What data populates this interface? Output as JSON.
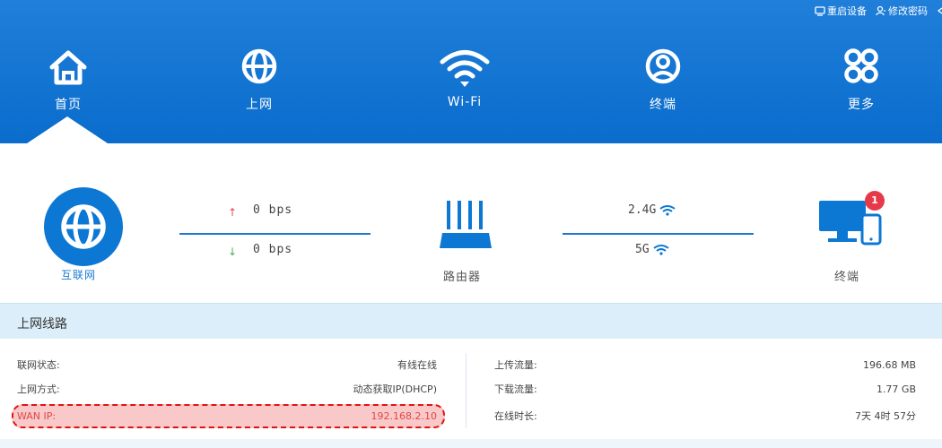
{
  "header": {
    "top_links": [
      {
        "label": "重启设备",
        "icon": "reboot-icon"
      },
      {
        "label": "修改密码",
        "icon": "user-key-icon"
      }
    ],
    "nav": [
      {
        "label": "首页",
        "icon": "home-icon",
        "active": true
      },
      {
        "label": "上网",
        "icon": "globe-icon"
      },
      {
        "label": "Wi-Fi",
        "icon": "wifi-icon"
      },
      {
        "label": "终端",
        "icon": "user-circle-icon"
      },
      {
        "label": "更多",
        "icon": "more-grid-icon"
      }
    ]
  },
  "topology": {
    "internet_label": "互联网",
    "upload_rate": "0 bps",
    "download_rate": "0 bps",
    "router_label": "路由器",
    "band_24": "2.4G",
    "band_5": "5G",
    "terminal_label": "终端",
    "terminal_badge": "1"
  },
  "section": {
    "title": "上网线路"
  },
  "wan_info": {
    "status_label": "联网状态:",
    "status_value": "有线在线",
    "mode_label": "上网方式:",
    "mode_value": "动态获取IP(DHCP)",
    "ip_label": "WAN IP:",
    "ip_value": "192.168.2.10"
  },
  "traffic_info": {
    "upload_label": "上传流量:",
    "upload_value": "196.68 MB",
    "download_label": "下载流量:",
    "download_value": "1.77 GB",
    "online_label": "在线时长:",
    "online_value": "7天 4时 57分"
  },
  "colors": {
    "primary": "#0d78d4",
    "header_bg": "#1f7fd9",
    "section_bg": "#dbeefa",
    "highlight_red": "#e01212",
    "badge_red": "#e6394a"
  }
}
